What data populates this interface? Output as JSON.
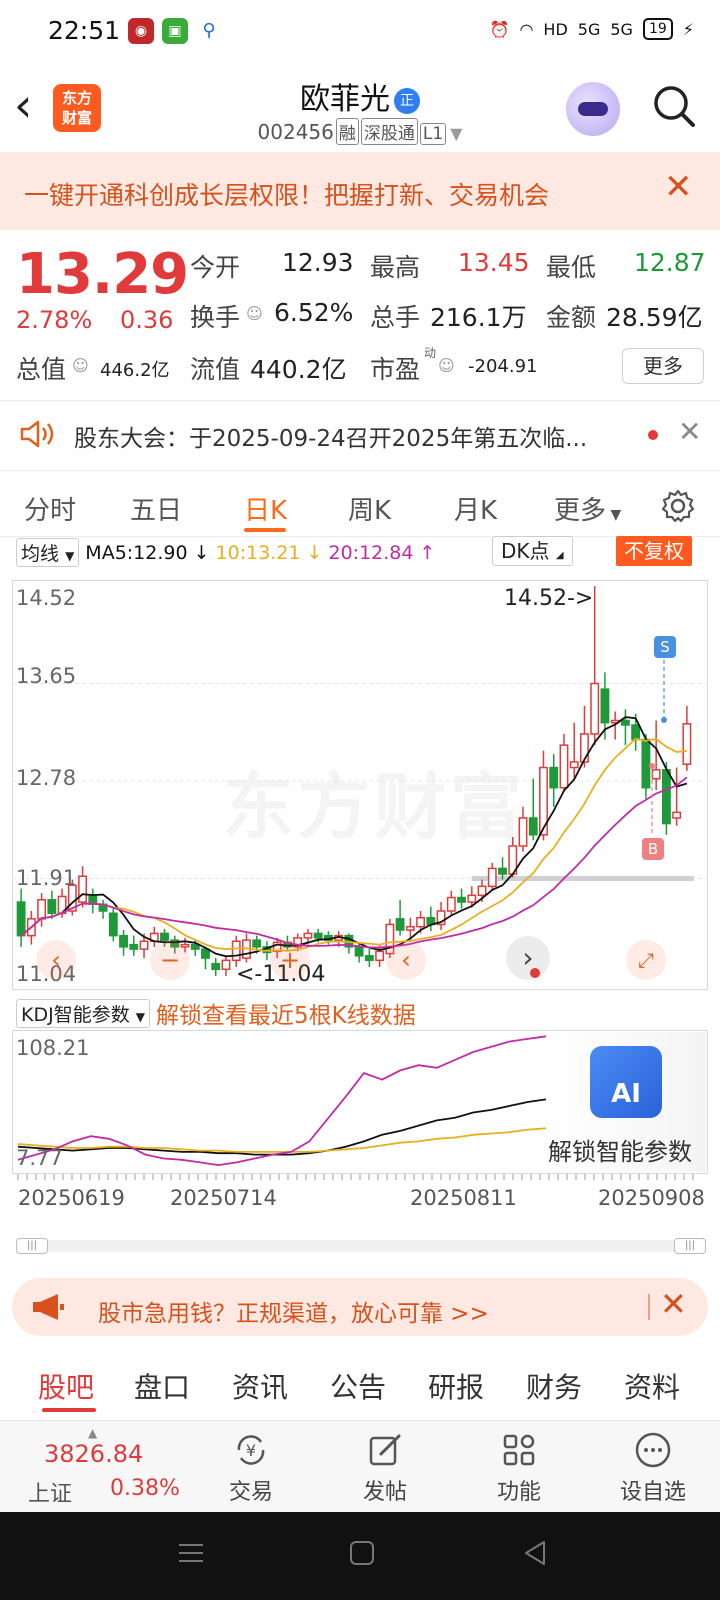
{
  "status_bar": {
    "time": "22:51",
    "network": "HD",
    "signal1": "5G",
    "signal2": "5G",
    "battery": "19"
  },
  "header": {
    "back_icon": "chevron-left-icon",
    "logo_line1": "东方",
    "logo_line2": "财富",
    "stock_name": "欧菲光",
    "name_badge": "正",
    "stock_code": "002456",
    "tag_margin": "融",
    "tag_connect": "深股通",
    "tag_level": "L1"
  },
  "promo": {
    "text": "一键开通科创成长层权限！把握打新、交易机会",
    "close": "✕"
  },
  "quote": {
    "price": "13.29",
    "change_pct": "2.78%",
    "change": "0.36",
    "open_label": "今开",
    "open": "12.93",
    "high_label": "最高",
    "high": "13.45",
    "low_label": "最低",
    "low": "12.87",
    "turnover_label": "换手",
    "turnover": "6.52%",
    "volume_label": "总手",
    "volume": "216.1万",
    "amount_label": "金额",
    "amount": "28.59亿",
    "mktcap_label": "总值",
    "mktcap": "446.2亿",
    "float_label": "流值",
    "float_cap": "440.2亿",
    "pe_label": "市盈",
    "pe_sup": "动",
    "pe": "-204.91",
    "more_label": "更多"
  },
  "notice": {
    "text": "股东大会：于2025-09-24召开2025年第五次临..."
  },
  "chart_tabs": {
    "items": [
      "分时",
      "五日",
      "日K",
      "周K",
      "月K",
      "更多"
    ],
    "active": "日K"
  },
  "ma_bar": {
    "selector": "均线",
    "ma5": "MA5:12.90",
    "ma10": "10:13.21",
    "ma20": "20:12.84",
    "dk": "DK点",
    "adjust": "不复权"
  },
  "colors": {
    "up": "#e03a3a",
    "down": "#1f9a3a",
    "accent": "#ff6a1a",
    "ma5": "#111111",
    "ma10": "#e8b020",
    "ma20": "#c02ca8"
  },
  "chart_data": [
    {
      "type": "candlestick",
      "title": "",
      "y_ticks": [
        "14.52",
        "13.65",
        "12.78",
        "11.91",
        "11.04"
      ],
      "ylim": [
        11.04,
        14.52
      ],
      "annotations": {
        "high": "14.52->",
        "low": "<-11.04",
        "sell_marker": "S",
        "buy_marker": "B"
      },
      "watermark": "东方财富",
      "candles": [
        {
          "o": 11.7,
          "c": 11.4,
          "h": 11.82,
          "l": 11.3
        },
        {
          "o": 11.4,
          "c": 11.55,
          "h": 11.62,
          "l": 11.32
        },
        {
          "o": 11.55,
          "c": 11.72,
          "h": 11.78,
          "l": 11.48
        },
        {
          "o": 11.72,
          "c": 11.6,
          "h": 11.8,
          "l": 11.55
        },
        {
          "o": 11.6,
          "c": 11.75,
          "h": 11.82,
          "l": 11.56
        },
        {
          "o": 11.62,
          "c": 11.85,
          "h": 11.9,
          "l": 11.58
        },
        {
          "o": 11.7,
          "c": 11.93,
          "h": 12.02,
          "l": 11.65
        },
        {
          "o": 11.75,
          "c": 11.68,
          "h": 11.82,
          "l": 11.6
        },
        {
          "o": 11.68,
          "c": 11.62,
          "h": 11.72,
          "l": 11.55
        },
        {
          "o": 11.6,
          "c": 11.4,
          "h": 11.65,
          "l": 11.35
        },
        {
          "o": 11.4,
          "c": 11.3,
          "h": 11.45,
          "l": 11.22
        },
        {
          "o": 11.32,
          "c": 11.28,
          "h": 11.4,
          "l": 11.22
        },
        {
          "o": 11.28,
          "c": 11.35,
          "h": 11.42,
          "l": 11.2
        },
        {
          "o": 11.35,
          "c": 11.42,
          "h": 11.48,
          "l": 11.3
        },
        {
          "o": 11.42,
          "c": 11.36,
          "h": 11.46,
          "l": 11.3
        },
        {
          "o": 11.36,
          "c": 11.3,
          "h": 11.4,
          "l": 11.24
        },
        {
          "o": 11.3,
          "c": 11.32,
          "h": 11.38,
          "l": 11.25
        },
        {
          "o": 11.32,
          "c": 11.28,
          "h": 11.36,
          "l": 11.22
        },
        {
          "o": 11.28,
          "c": 11.2,
          "h": 11.3,
          "l": 11.1
        },
        {
          "o": 11.15,
          "c": 11.1,
          "h": 11.2,
          "l": 11.04
        },
        {
          "o": 11.1,
          "c": 11.18,
          "h": 11.22,
          "l": 11.04
        },
        {
          "o": 11.18,
          "c": 11.35,
          "h": 11.4,
          "l": 11.12
        },
        {
          "o": 11.2,
          "c": 11.36,
          "h": 11.42,
          "l": 11.16
        },
        {
          "o": 11.36,
          "c": 11.3,
          "h": 11.4,
          "l": 11.24
        },
        {
          "o": 11.3,
          "c": 11.25,
          "h": 11.35,
          "l": 11.18
        },
        {
          "o": 11.26,
          "c": 11.34,
          "h": 11.38,
          "l": 11.2
        },
        {
          "o": 11.34,
          "c": 11.3,
          "h": 11.4,
          "l": 11.26
        },
        {
          "o": 11.3,
          "c": 11.38,
          "h": 11.42,
          "l": 11.26
        },
        {
          "o": 11.38,
          "c": 11.42,
          "h": 11.46,
          "l": 11.32
        },
        {
          "o": 11.42,
          "c": 11.38,
          "h": 11.46,
          "l": 11.34
        },
        {
          "o": 11.4,
          "c": 11.36,
          "h": 11.44,
          "l": 11.32
        },
        {
          "o": 11.36,
          "c": 11.4,
          "h": 11.44,
          "l": 11.3
        },
        {
          "o": 11.4,
          "c": 11.3,
          "h": 11.42,
          "l": 11.24
        },
        {
          "o": 11.3,
          "c": 11.22,
          "h": 11.34,
          "l": 11.16
        },
        {
          "o": 11.22,
          "c": 11.18,
          "h": 11.28,
          "l": 11.12
        },
        {
          "o": 11.18,
          "c": 11.26,
          "h": 11.32,
          "l": 11.12
        },
        {
          "o": 11.24,
          "c": 11.5,
          "h": 11.55,
          "l": 11.2
        },
        {
          "o": 11.55,
          "c": 11.45,
          "h": 11.72,
          "l": 11.4
        },
        {
          "o": 11.45,
          "c": 11.48,
          "h": 11.56,
          "l": 11.38
        },
        {
          "o": 11.48,
          "c": 11.56,
          "h": 11.62,
          "l": 11.42
        },
        {
          "o": 11.56,
          "c": 11.5,
          "h": 11.66,
          "l": 11.44
        },
        {
          "o": 11.5,
          "c": 11.62,
          "h": 11.7,
          "l": 11.45
        },
        {
          "o": 11.62,
          "c": 11.74,
          "h": 11.8,
          "l": 11.58
        },
        {
          "o": 11.74,
          "c": 11.7,
          "h": 11.82,
          "l": 11.64
        },
        {
          "o": 11.7,
          "c": 11.76,
          "h": 11.84,
          "l": 11.65
        },
        {
          "o": 11.76,
          "c": 11.84,
          "h": 11.9,
          "l": 11.7
        },
        {
          "o": 11.84,
          "c": 12.0,
          "h": 12.05,
          "l": 11.8
        },
        {
          "o": 12.0,
          "c": 11.95,
          "h": 12.1,
          "l": 11.9
        },
        {
          "o": 11.95,
          "c": 12.2,
          "h": 12.28,
          "l": 11.92
        },
        {
          "o": 12.2,
          "c": 12.45,
          "h": 12.55,
          "l": 12.15
        },
        {
          "o": 12.45,
          "c": 12.3,
          "h": 12.8,
          "l": 12.25
        },
        {
          "o": 12.3,
          "c": 12.9,
          "h": 13.05,
          "l": 12.25
        },
        {
          "o": 12.9,
          "c": 12.72,
          "h": 13.02,
          "l": 12.55
        },
        {
          "o": 12.72,
          "c": 13.1,
          "h": 13.2,
          "l": 12.68
        },
        {
          "o": 12.9,
          "c": 12.95,
          "h": 13.3,
          "l": 12.8
        },
        {
          "o": 12.95,
          "c": 13.2,
          "h": 13.45,
          "l": 12.9
        },
        {
          "o": 13.2,
          "c": 13.65,
          "h": 14.52,
          "l": 13.1
        },
        {
          "o": 13.6,
          "c": 13.3,
          "h": 13.75,
          "l": 13.15
        },
        {
          "o": 13.3,
          "c": 13.32,
          "h": 13.4,
          "l": 13.15
        },
        {
          "o": 13.32,
          "c": 13.28,
          "h": 13.42,
          "l": 13.1
        },
        {
          "o": 13.28,
          "c": 13.15,
          "h": 13.38,
          "l": 13.05
        },
        {
          "o": 13.15,
          "c": 12.72,
          "h": 13.2,
          "l": 12.62
        },
        {
          "o": 12.8,
          "c": 12.88,
          "h": 13.32,
          "l": 12.7
        },
        {
          "o": 12.88,
          "c": 12.4,
          "h": 12.95,
          "l": 12.3
        },
        {
          "o": 12.45,
          "c": 12.5,
          "h": 12.9,
          "l": 12.38
        },
        {
          "o": 12.93,
          "c": 13.29,
          "h": 13.45,
          "l": 12.87
        }
      ]
    },
    {
      "type": "line",
      "title": "",
      "selector": "KDJ智能参数",
      "unlock_text": "解锁查看最近5根K线数据",
      "y_ticks": [
        "108.21",
        "7.77"
      ],
      "ylim": [
        7.77,
        108.21
      ],
      "series": [
        {
          "values": [
            24,
            23,
            22,
            21,
            22,
            23,
            23,
            22,
            21,
            20,
            20,
            19,
            19,
            18,
            18,
            18,
            19,
            21,
            24,
            28,
            33,
            36,
            40,
            44,
            46,
            50,
            52,
            55,
            58,
            60
          ]
        },
        {
          "values": [
            26,
            25,
            24,
            23,
            23,
            24,
            24,
            23,
            23,
            22,
            21,
            21,
            20,
            20,
            20,
            20,
            20,
            21,
            22,
            23,
            25,
            27,
            28,
            30,
            31,
            33,
            34,
            35,
            37,
            38
          ]
        },
        {
          "values": [
            14,
            18,
            22,
            28,
            32,
            30,
            25,
            18,
            15,
            14,
            12,
            10,
            12,
            15,
            18,
            20,
            28,
            45,
            62,
            80,
            75,
            82,
            86,
            84,
            90,
            96,
            100,
            104,
            106,
            108
          ]
        }
      ],
      "x_ticks": [
        "20250619",
        "20250714",
        "20250811",
        "20250908"
      ]
    }
  ],
  "ai_panel": {
    "icon_text": "AI",
    "label": "解锁智能参数"
  },
  "loan_banner": {
    "text": "股市急用钱？正规渠道，放心可靠 >>",
    "close": "✕"
  },
  "bottom_tabs": {
    "items": [
      "股吧",
      "盘口",
      "资讯",
      "公告",
      "研报",
      "财务",
      "资料"
    ],
    "active": "股吧"
  },
  "bottom_bar": {
    "index_value": "3826.84",
    "index_name": "上证",
    "index_pct": "0.38%",
    "trade": "交易",
    "post": "发帖",
    "functions": "功能",
    "watchlist": "设自选"
  }
}
